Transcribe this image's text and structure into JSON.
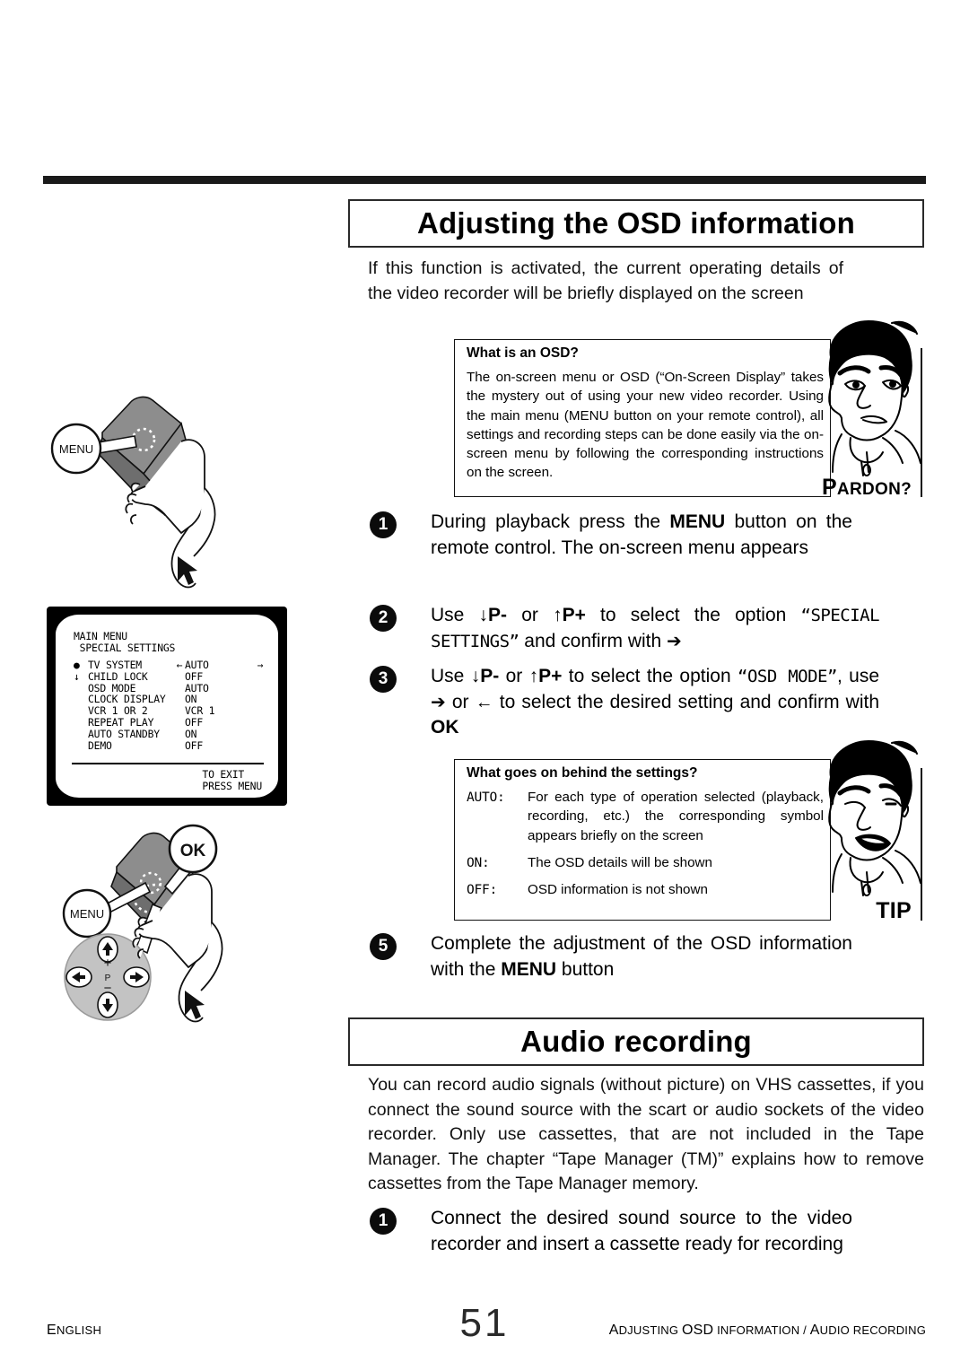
{
  "document": {
    "title_osd": "Adjusting the OSD information",
    "title_audio": "Audio recording",
    "intro_para": "If this function is activated, the current operating details of the video recorder will be briefly displayed on the screen",
    "audio_para": "You can record audio signals (without picture) on VHS cassettes, if you connect the sound source with the scart or audio sockets of the video recorder. Only use cassettes, that are not included in the Tape Manager. The chapter “Tape Manager (TM)” explains how to remove cassettes from the Tape Manager memory."
  },
  "info_box_osd": {
    "heading": "What is an OSD?",
    "body": "The on-screen menu or OSD (“On-Screen Display” takes the mystery out of using your new video recorder. Using the main menu (MENU button on your remote control), all settings and recording steps can be done easily via the on-screen menu by following the corresponding instructions on the screen.",
    "caption_first": "P",
    "caption_rest": "ARDON?"
  },
  "info_box_tip": {
    "heading": "What goes on behind the settings?",
    "rows": [
      {
        "term": "AUTO:",
        "desc": "For each type of operation selected (playback, recording, etc.) the corresponding symbol appears briefly on the screen"
      },
      {
        "term": "ON:",
        "desc": "The OSD details will be shown"
      },
      {
        "term": "OFF:",
        "desc": "OSD information is not shown"
      }
    ],
    "caption": "TIP"
  },
  "steps_osd": [
    {
      "num": "1",
      "text_a": "During playback press the ",
      "bold_a": "MENU",
      "text_b": " button on the remote control. The on-screen menu appears"
    },
    {
      "num": "2",
      "text_a": "Use ",
      "key_down": "↓P-",
      "text_mid": " or ",
      "key_up": "↑P+",
      "text_b": " to select the option ",
      "mono": "“SPECIAL SETTINGS”",
      "text_c": " and confirm with ",
      "arrow": "➔"
    },
    {
      "num": "3",
      "text_a": "Use ",
      "key_down": "↓P-",
      "text_mid": " or ",
      "key_up": "↑P+",
      "text_b": " to select the option ",
      "mono": "“OSD MODE”",
      "text_c": ", use ",
      "arrow_r": "➔",
      "text_d": " or ",
      "arrow_l": "←",
      "text_e": " to select the desired setting and confirm with ",
      "bold_ok": "OK"
    },
    {
      "num": "5",
      "text_a": "Complete the adjustment of the OSD information with the ",
      "bold_a": "MENU",
      "text_b": " button"
    }
  ],
  "steps_audio": [
    {
      "num": "1",
      "text_a": "Connect the desired sound source to the video recorder and insert a cassette ready for recording"
    }
  ],
  "osd_screen": {
    "head_line1": "MAIN MENU",
    "head_line2": " SPECIAL SETTINGS",
    "rows": [
      {
        "mark": "●",
        "label": "TV SYSTEM",
        "left_arrow": "←",
        "value": "AUTO",
        "right_arrow": "→"
      },
      {
        "mark": "↓",
        "label": "CHILD LOCK",
        "left_arrow": "",
        "value": "OFF",
        "right_arrow": ""
      },
      {
        "mark": "",
        "label": "OSD MODE",
        "left_arrow": "",
        "value": "AUTO",
        "right_arrow": ""
      },
      {
        "mark": "",
        "label": "CLOCK DISPLAY",
        "left_arrow": "",
        "value": "ON",
        "right_arrow": ""
      },
      {
        "mark": "",
        "label": "VCR 1 OR 2",
        "left_arrow": "",
        "value": "VCR 1",
        "right_arrow": ""
      },
      {
        "mark": "",
        "label": "REPEAT PLAY",
        "left_arrow": "",
        "value": "OFF",
        "right_arrow": ""
      },
      {
        "mark": "",
        "label": "AUTO STANDBY",
        "left_arrow": "",
        "value": "ON",
        "right_arrow": ""
      },
      {
        "mark": "",
        "label": "DEMO",
        "left_arrow": "",
        "value": "OFF",
        "right_arrow": ""
      }
    ],
    "exit_line1": "TO EXIT",
    "exit_line2": "PRESS MENU"
  },
  "illustration_top": {
    "callout_menu": "MENU"
  },
  "illustration_bottom": {
    "callout_menu": "MENU",
    "callout_ok": "OK",
    "pad_label": "P",
    "pad_plus": "+",
    "pad_minus": "−"
  },
  "footer": {
    "language_first": "E",
    "language_rest": "NGLISH",
    "page_number": "51",
    "section_first": "A",
    "section_rest": "DJUSTING ",
    "section_osd": "OSD",
    "section_rest2": " INFORMATION / ",
    "section_a2": "A",
    "section_rest3": "UDIO RECORDING"
  },
  "colors": {
    "ink": "#000000",
    "rule": "#1a1a1a",
    "bullet": "#0b0b0b",
    "remote_body": "#8d8d8d",
    "remote_dark": "#6e6e6e"
  }
}
